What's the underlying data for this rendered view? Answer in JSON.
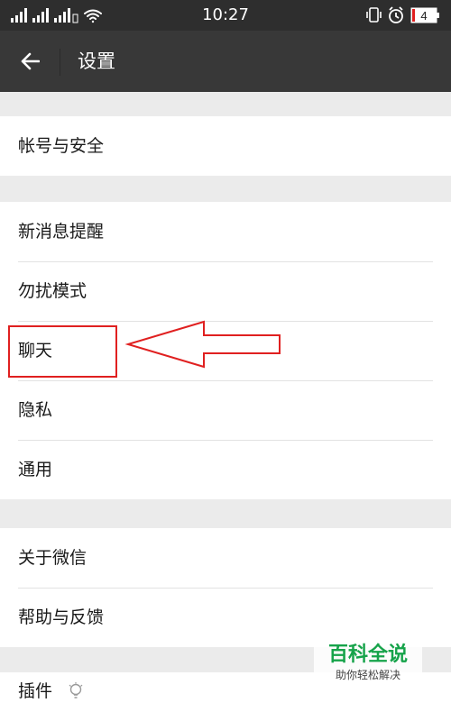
{
  "status_bar": {
    "time": "10:27",
    "battery": "4",
    "icons": [
      "signal-icon",
      "signal-2-icon",
      "wifi-icon",
      "vibrate-icon",
      "alarm-icon",
      "battery-icon"
    ]
  },
  "header": {
    "title": "设置",
    "back_icon": "back-arrow-icon"
  },
  "settings": {
    "group1": [
      "帐号与安全"
    ],
    "group2": [
      "新消息提醒",
      "勿扰模式",
      "聊天",
      "隐私",
      "通用"
    ],
    "group3": [
      "关于微信",
      "帮助与反馈"
    ],
    "group4": [
      "插件"
    ]
  },
  "annotation": {
    "highlighted_item": "聊天",
    "color": "#e02020"
  },
  "watermark": {
    "title": "百科全说",
    "subtitle": "助你轻松解决"
  },
  "colors": {
    "header_bg": "#383838",
    "status_bg": "#2e2e2e",
    "page_bg": "#ebebeb",
    "watermark_green": "#16a34a"
  }
}
